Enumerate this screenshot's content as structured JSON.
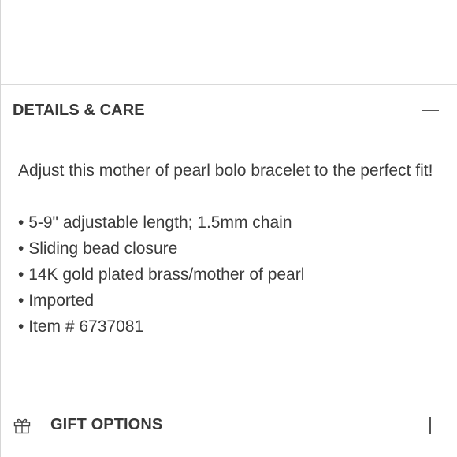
{
  "details": {
    "title": "DETAILS & CARE",
    "expanded": true,
    "description": "Adjust this mother of pearl bolo bracelet to the perfect fit!",
    "bullets": [
      "5-9\" adjustable length; 1.5mm chain",
      "Sliding bead closure",
      "14K gold plated brass/mother of pearl",
      "Imported",
      "Item # 6737081"
    ],
    "toggle_icon": "minus-icon"
  },
  "gift": {
    "title": "GIFT OPTIONS",
    "expanded": false,
    "leading_icon": "gift-icon",
    "toggle_icon": "plus-icon"
  }
}
